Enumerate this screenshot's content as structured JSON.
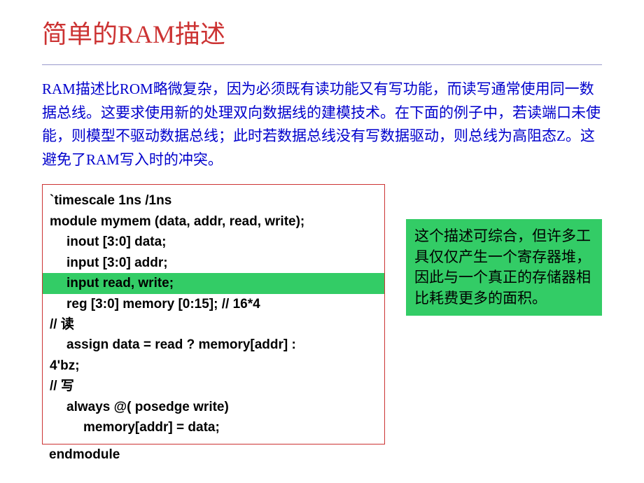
{
  "title": "简单的RAM描述",
  "description": "RAM描述比ROM略微复杂，因为必须既有读功能又有写功能，而读写通常使用同一数据总线。这要求使用新的处理双向数据线的建模技术。在下面的例子中，若读端口未使能，则模型不驱动数据总线；此时若数据总线没有写数据驱动，则总线为高阻态Z。这避免了RAM写入时的冲突。",
  "code": {
    "line1": "`timescale 1ns /1ns",
    "line2": "module mymem (data, addr, read, write);",
    "line3": "inout [3:0] data;",
    "line4": "input [3:0] addr;",
    "line5": "input read, write;",
    "line6": "reg [3:0] memory [0:15]; // 16*4",
    "line7": "// 读",
    "line8": "assign data = read ? memory[addr] :",
    "line9": "4'bz;",
    "line10": "// 写",
    "line11": "always @( posedge write)",
    "line12": "memory[addr] = data;",
    "endmodule": "endmodule"
  },
  "note": "这个描述可综合，但许多工具仅仅产生一个寄存器堆，因此与一个真正的存储器相比耗费更多的面积。"
}
